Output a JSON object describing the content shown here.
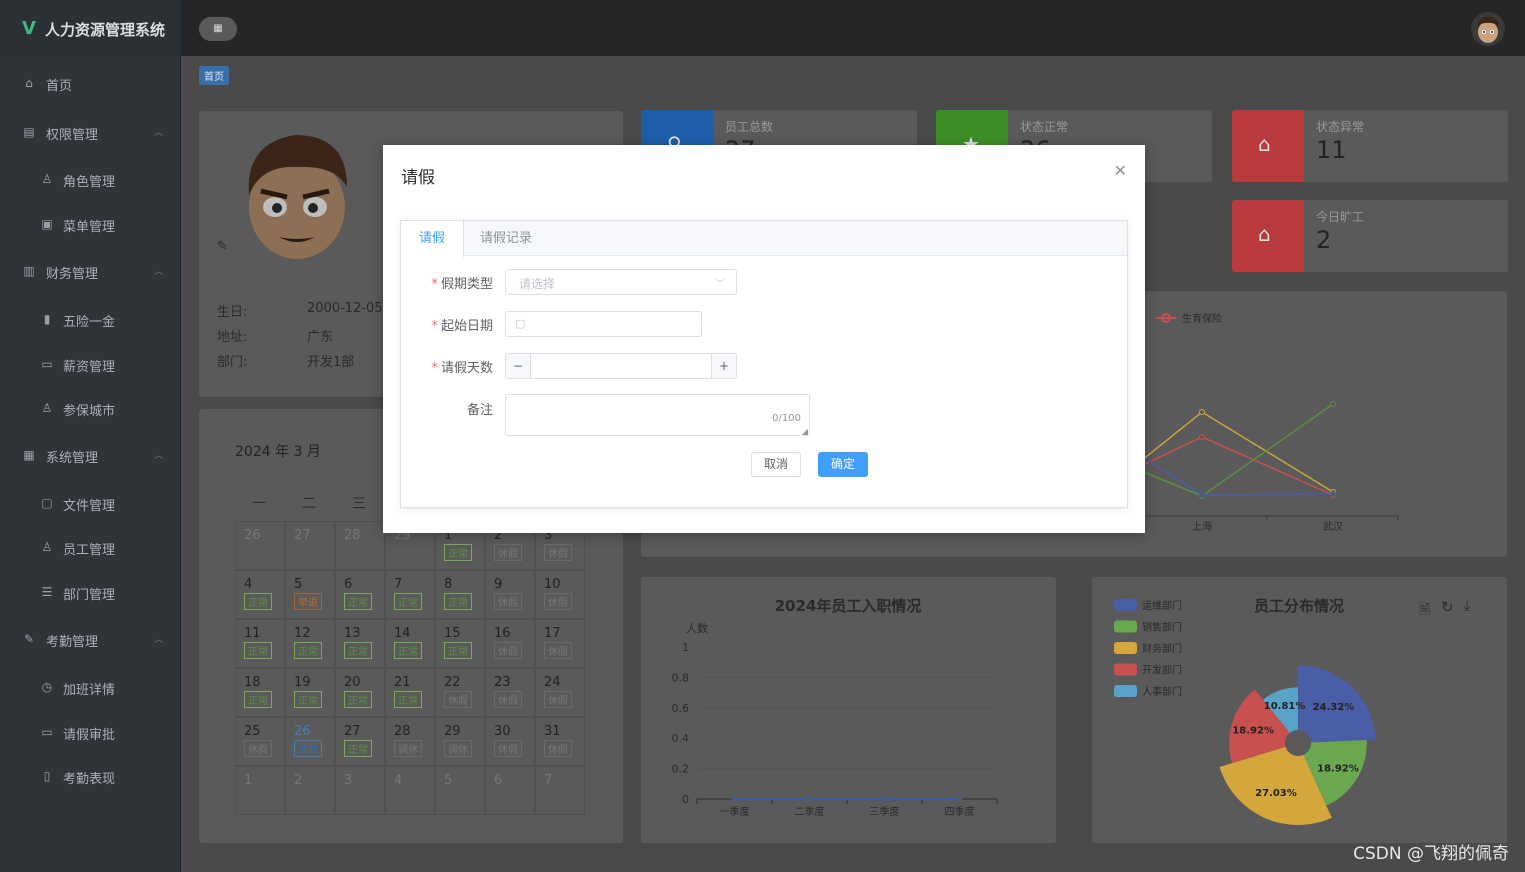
{
  "app": {
    "title": "人力资源管理系统",
    "logo": "V"
  },
  "sidebar": {
    "items": [
      {
        "label": "首页",
        "icon": "home-icon",
        "level": 1
      },
      {
        "label": "权限管理",
        "icon": "lock-icon",
        "level": 1,
        "expanded": true
      },
      {
        "label": "角色管理",
        "icon": "user-icon",
        "level": 2
      },
      {
        "label": "菜单管理",
        "icon": "menu-icon",
        "level": 2
      },
      {
        "label": "财务管理",
        "icon": "wallet-icon",
        "level": 1,
        "expanded": true
      },
      {
        "label": "五险一金",
        "icon": "bar-chart-icon",
        "level": 2
      },
      {
        "label": "薪资管理",
        "icon": "money-icon",
        "level": 2
      },
      {
        "label": "参保城市",
        "icon": "location-icon",
        "level": 2
      },
      {
        "label": "系统管理",
        "icon": "system-icon",
        "level": 1,
        "expanded": true
      },
      {
        "label": "文件管理",
        "icon": "folder-icon",
        "level": 2
      },
      {
        "label": "员工管理",
        "icon": "user-icon",
        "level": 2
      },
      {
        "label": "部门管理",
        "icon": "list-icon",
        "level": 2
      },
      {
        "label": "考勤管理",
        "icon": "edit-icon",
        "level": 1,
        "expanded": true
      },
      {
        "label": "加班详情",
        "icon": "clock-icon",
        "level": 2
      },
      {
        "label": "请假审批",
        "icon": "briefcase-icon",
        "level": 2
      },
      {
        "label": "考勤表现",
        "icon": "book-icon",
        "level": 2
      }
    ]
  },
  "breadcrumb": {
    "current": "首页"
  },
  "profile": {
    "rows": [
      {
        "label": "生日:",
        "value": "2000-12-05"
      },
      {
        "label": "地址:",
        "value": "广东"
      },
      {
        "label": "部门:",
        "value": "开发1部"
      }
    ]
  },
  "stats": [
    {
      "title": "员工总数",
      "value": "27",
      "color": "#1e5faa",
      "icon": "search-icon"
    },
    {
      "title": "状态正常",
      "value": "26",
      "color": "#3e8f27",
      "icon": "star-icon"
    },
    {
      "title": "状态异常",
      "value": "11",
      "color": "#b83a3d",
      "icon": "bag-icon"
    },
    {
      "title": "今日旷工",
      "value": "2",
      "color": "#b83a3d",
      "icon": "lock-icon"
    }
  ],
  "calendar": {
    "title": "2024 年 3 月",
    "weekdays": [
      "一",
      "二",
      "三"
    ],
    "cells": [
      {
        "d": "26",
        "t": "",
        "k": "out"
      },
      {
        "d": "27",
        "t": "",
        "k": "out"
      },
      {
        "d": "28",
        "t": "",
        "k": "out"
      },
      {
        "d": "29",
        "t": "",
        "k": "out"
      },
      {
        "d": "1",
        "t": "正常",
        "k": "ok"
      },
      {
        "d": "2",
        "t": "休假",
        "k": "off"
      },
      {
        "d": "3",
        "t": "休假",
        "k": "off"
      },
      {
        "d": "4",
        "t": "正常",
        "k": "ok"
      },
      {
        "d": "5",
        "t": "早退",
        "k": "warn"
      },
      {
        "d": "6",
        "t": "正常",
        "k": "ok"
      },
      {
        "d": "7",
        "t": "正常",
        "k": "ok"
      },
      {
        "d": "8",
        "t": "正常",
        "k": "ok"
      },
      {
        "d": "9",
        "t": "休假",
        "k": "off"
      },
      {
        "d": "10",
        "t": "休假",
        "k": "off"
      },
      {
        "d": "11",
        "t": "正常",
        "k": "ok"
      },
      {
        "d": "12",
        "t": "正常",
        "k": "ok"
      },
      {
        "d": "13",
        "t": "正常",
        "k": "ok"
      },
      {
        "d": "14",
        "t": "正常",
        "k": "ok"
      },
      {
        "d": "15",
        "t": "正常",
        "k": "ok"
      },
      {
        "d": "16",
        "t": "休假",
        "k": "off"
      },
      {
        "d": "17",
        "t": "休假",
        "k": "off"
      },
      {
        "d": "18",
        "t": "正常",
        "k": "ok"
      },
      {
        "d": "19",
        "t": "正常",
        "k": "ok"
      },
      {
        "d": "20",
        "t": "正常",
        "k": "ok"
      },
      {
        "d": "21",
        "t": "正常",
        "k": "ok"
      },
      {
        "d": "22",
        "t": "休假",
        "k": "off"
      },
      {
        "d": "23",
        "t": "休假",
        "k": "off"
      },
      {
        "d": "24",
        "t": "休假",
        "k": "off"
      },
      {
        "d": "25",
        "t": "休假",
        "k": "off"
      },
      {
        "d": "26",
        "t": "迟到",
        "k": "late"
      },
      {
        "d": "27",
        "t": "正常",
        "k": "ok"
      },
      {
        "d": "28",
        "t": "调休",
        "k": "off"
      },
      {
        "d": "29",
        "t": "调休",
        "k": "off"
      },
      {
        "d": "30",
        "t": "休假",
        "k": "off"
      },
      {
        "d": "31",
        "t": "休假",
        "k": "off"
      },
      {
        "d": "1",
        "t": "",
        "k": "out"
      },
      {
        "d": "2",
        "t": "",
        "k": "out"
      },
      {
        "d": "3",
        "t": "",
        "k": "out"
      },
      {
        "d": "4",
        "t": "",
        "k": "out"
      },
      {
        "d": "5",
        "t": "",
        "k": "out"
      },
      {
        "d": "6",
        "t": "",
        "k": "out"
      },
      {
        "d": "7",
        "t": "",
        "k": "out"
      }
    ]
  },
  "dialog": {
    "title": "请假",
    "tabs": [
      "请假",
      "请假记录"
    ],
    "fields": {
      "leave_type": {
        "label": "假期类型",
        "placeholder": "请选择"
      },
      "start_date": {
        "label": "起始日期"
      },
      "days": {
        "label": "请假天数",
        "minus": "−",
        "plus": "+"
      },
      "remark": {
        "label": "备注",
        "counter": "0/100"
      }
    },
    "cancel": "取消",
    "confirm": "确定"
  },
  "chart_data": [
    {
      "type": "line",
      "title": "",
      "x": [
        "上海",
        "武汉"
      ],
      "legend_visible": [
        "生育保险"
      ],
      "series": [
        {
          "name": "",
          "color": "#c9a33c",
          "values": [
            null,
            null
          ]
        },
        {
          "name": "",
          "color": "#c8504f",
          "values": [
            null,
            null
          ]
        },
        {
          "name": "",
          "color": "#5a8f3c",
          "values": [
            null,
            null
          ]
        },
        {
          "name": "",
          "color": "#4a5ea8",
          "values": [
            null,
            null
          ]
        }
      ]
    },
    {
      "type": "line",
      "title": "2024年员工入职情况",
      "ylabel": "人数",
      "categories": [
        "一季度",
        "二季度",
        "三季度",
        "四季度"
      ],
      "yticks": [
        "1",
        "0.8",
        "0.6",
        "0.4",
        "0.2",
        "0"
      ],
      "ylim": [
        0,
        1
      ],
      "series": [
        {
          "name": "",
          "values": [
            0,
            0,
            0,
            0
          ]
        }
      ]
    },
    {
      "type": "pie",
      "title": "员工分布情况",
      "legend": [
        {
          "name": "运维部门",
          "color": "#4a5ea8"
        },
        {
          "name": "销售部门",
          "color": "#6aa84f"
        },
        {
          "name": "财务部门",
          "color": "#d4a73c"
        },
        {
          "name": "开发部门",
          "color": "#c8504f"
        },
        {
          "name": "人事部门",
          "color": "#5aa3c8"
        }
      ],
      "slices": [
        {
          "name": "运维部门",
          "value": 24.32,
          "label": "24.32%",
          "color": "#4a5ea8"
        },
        {
          "name": "销售部门",
          "value": 18.92,
          "label": "18.92%",
          "color": "#6aa84f"
        },
        {
          "name": "财务部门",
          "value": 27.03,
          "label": "27.03%",
          "color": "#d4a73c"
        },
        {
          "name": "开发部门",
          "value": 18.92,
          "label": "18.92%",
          "color": "#c8504f"
        },
        {
          "name": "人事部门",
          "value": 10.81,
          "label": "10.81%",
          "color": "#5aa3c8"
        }
      ]
    }
  ],
  "watermark": "CSDN @飞翔的佩奇"
}
